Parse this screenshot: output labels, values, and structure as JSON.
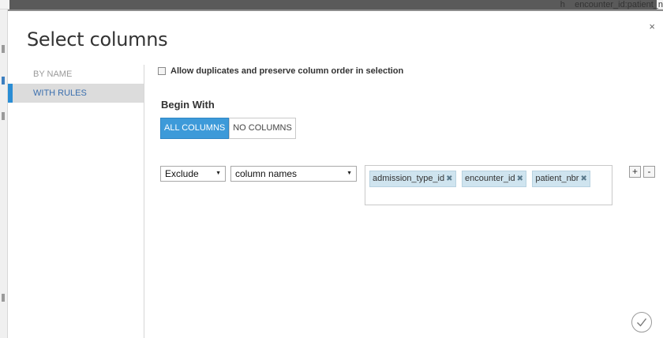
{
  "background": {
    "top_text": "h    encounter_id:patient_n"
  },
  "dialog": {
    "title": "Select columns",
    "close_glyph": "×",
    "close_icon": "close-icon",
    "ok_icon": "checkmark-icon"
  },
  "nav": {
    "items": [
      {
        "label": "BY NAME",
        "active": false
      },
      {
        "label": "WITH RULES",
        "active": true
      }
    ]
  },
  "main": {
    "duplicates_label": "Allow duplicates and preserve column order in selection",
    "duplicates_checked": false,
    "begin_with_label": "Begin With",
    "begin_with_options": [
      "ALL COLUMNS",
      "NO COLUMNS"
    ],
    "begin_with_selected": "ALL COLUMNS",
    "rule": {
      "action": "Exclude",
      "criteria": "column names",
      "tokens": [
        "admission_type_id",
        "encounter_id",
        "patient_nbr"
      ]
    },
    "add_label": "+",
    "remove_label": "-"
  },
  "colors": {
    "accent": "#3d9ad9",
    "nav_active_bar": "#2a8dd4",
    "token_bg": "#cfe4ef"
  }
}
